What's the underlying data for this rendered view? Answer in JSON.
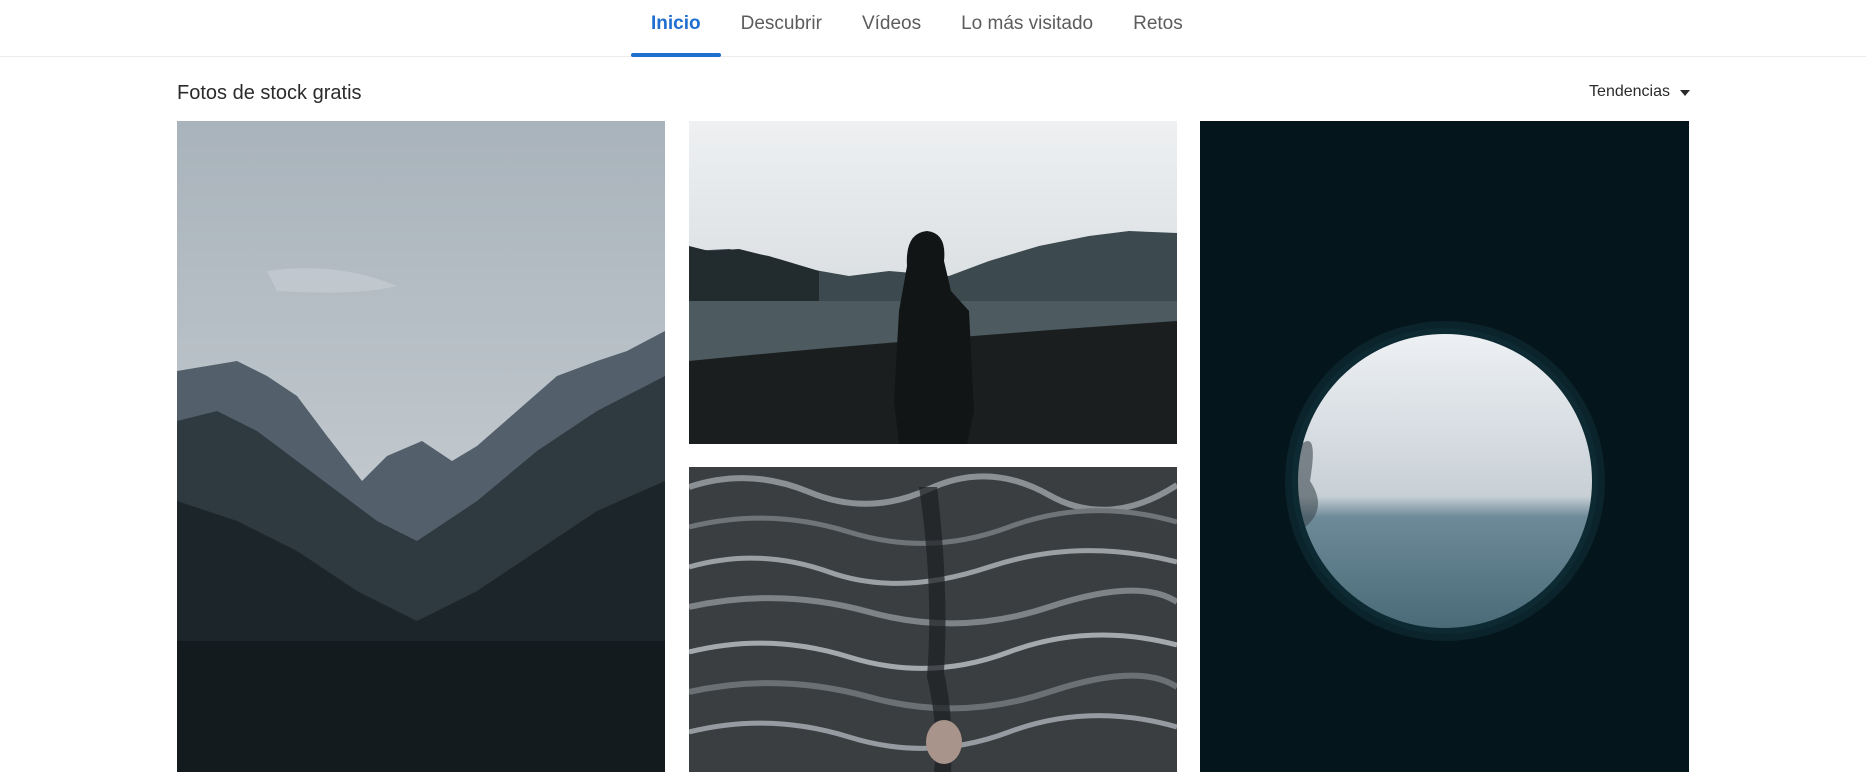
{
  "nav": {
    "tabs": [
      {
        "label": "Inicio",
        "active": true
      },
      {
        "label": "Descubrir",
        "active": false
      },
      {
        "label": "Vídeos",
        "active": false
      },
      {
        "label": "Lo más visitado",
        "active": false
      },
      {
        "label": "Retos",
        "active": false
      }
    ]
  },
  "gallery": {
    "title": "Fotos de stock gratis",
    "sort_label": "Tendencias"
  },
  "colors": {
    "accent": "#1f6fd0"
  }
}
